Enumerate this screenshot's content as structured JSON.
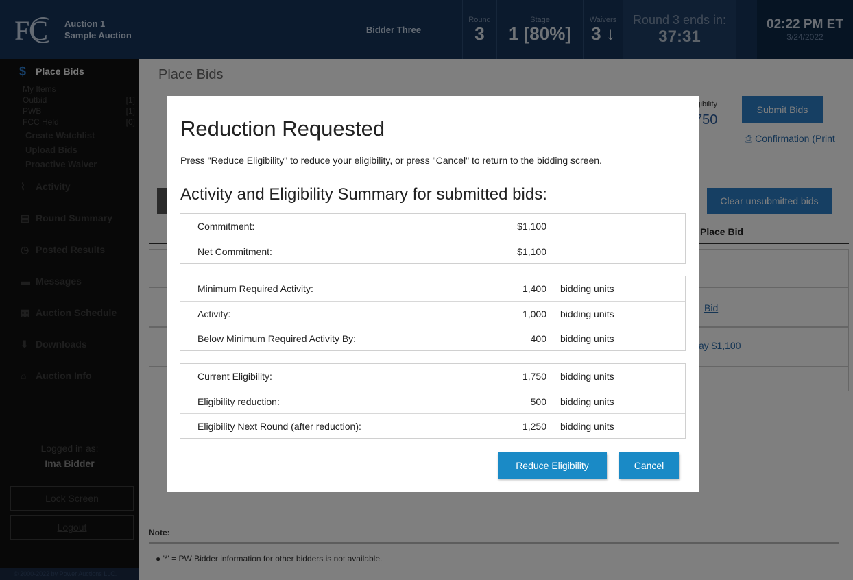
{
  "header": {
    "auction_name": "Auction 1",
    "auction_sub": "Sample Auction",
    "bidder": "Bidder Three",
    "round_label": "Round",
    "round_value": "3",
    "stage_label": "Stage",
    "stage_value": "1 [80%]",
    "waivers_label": "Waivers",
    "waivers_value": "3 ↓",
    "ends_label": "Round 3 ends in:",
    "ends_value": "37:31",
    "time": "02:22 PM ET",
    "date": "3/24/2022"
  },
  "sidebar": {
    "active": "Place Bids",
    "sub_items": [
      {
        "label": "My Items",
        "count": ""
      },
      {
        "label": "Outbid",
        "count": "[1]"
      },
      {
        "label": "PWB",
        "count": "[1]"
      },
      {
        "label": "FCC Held",
        "count": "[0]"
      }
    ],
    "links": [
      "Create Watchlist",
      "Upload Bids",
      "Proactive Waiver"
    ],
    "nav": [
      {
        "icon": "activity-icon",
        "label": "Activity"
      },
      {
        "icon": "round-summary-icon",
        "label": "Round Summary"
      },
      {
        "icon": "posted-results-icon",
        "label": "Posted Results"
      },
      {
        "icon": "messages-icon",
        "label": "Messages"
      },
      {
        "icon": "calendar-icon",
        "label": "Auction Schedule"
      },
      {
        "icon": "downloads-icon",
        "label": "Downloads"
      },
      {
        "icon": "home-icon",
        "label": "Auction Info"
      }
    ],
    "logged_in_label": "Logged in as:",
    "user": "Ima Bidder",
    "lock_screen": "Lock Screen",
    "logout": "Logout",
    "copyright": "© 2000-2022 by Power Auctions LLC."
  },
  "main": {
    "page_title": "Place Bids",
    "eligibility_label": "igibility",
    "eligibility_value": "750",
    "submit_bids": "Submit Bids",
    "confirmation": "Confirmation (Print",
    "clear_unsubmitted": "Clear unsubmitted bids",
    "place_bid_header": "Place Bid",
    "bid_link": "Bid",
    "pay_link": "ay $1,100",
    "note_label": "Note:",
    "note_text": "'*' = PW Bidder information for other bidders is not available."
  },
  "modal": {
    "title": "Reduction Requested",
    "description": "Press \"Reduce Eligibility\" to reduce your eligibility, or press \"Cancel\" to return to the bidding screen.",
    "subtitle": "Activity and Eligibility Summary for submitted bids:",
    "group1": [
      {
        "label": "Commitment:",
        "value": "$1,100",
        "unit": ""
      },
      {
        "label": "Net Commitment:",
        "value": "$1,100",
        "unit": ""
      }
    ],
    "group2": [
      {
        "label": "Minimum Required Activity:",
        "value": "1,400",
        "unit": "bidding units"
      },
      {
        "label": "Activity:",
        "value": "1,000",
        "unit": "bidding units"
      },
      {
        "label": "Below Minimum Required Activity By:",
        "value": "400",
        "unit": "bidding units"
      }
    ],
    "group3": [
      {
        "label": "Current Eligibility:",
        "value": "1,750",
        "unit": "bidding units"
      },
      {
        "label": "Eligibility reduction:",
        "value": "500",
        "unit": "bidding units"
      },
      {
        "label": "Eligibility Next Round (after reduction):",
        "value": "1,250",
        "unit": "bidding units"
      }
    ],
    "reduce_button": "Reduce Eligibility",
    "cancel_button": "Cancel"
  }
}
